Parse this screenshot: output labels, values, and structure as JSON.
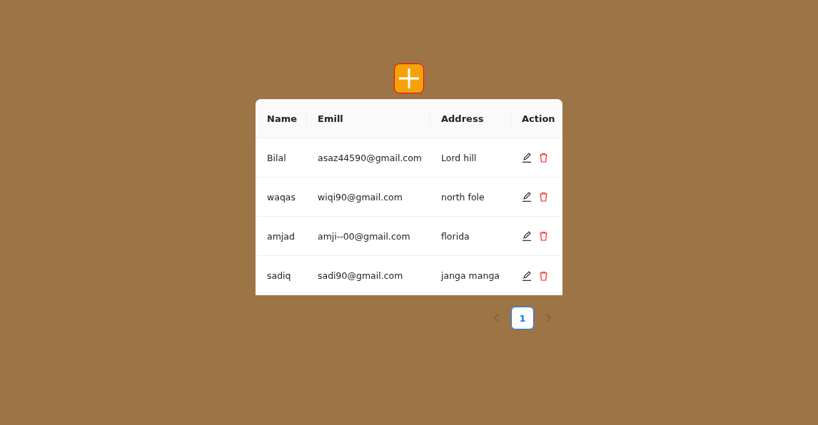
{
  "table": {
    "columns": [
      "Name",
      "Emill",
      "Address",
      "Action"
    ],
    "rows": [
      {
        "name": "Bilal",
        "email": "asaz44590@gmail.com",
        "address": "Lord hill"
      },
      {
        "name": "waqas",
        "email": "wiqi90@gmail.com",
        "address": "north fole"
      },
      {
        "name": "amjad",
        "email": "amji--00@gmail.com",
        "address": "florida"
      },
      {
        "name": "sadiq",
        "email": "sadi90@gmail.com",
        "address": "janga manga"
      }
    ]
  },
  "pagination": {
    "prev_disabled": true,
    "next_disabled": true,
    "pages": [
      {
        "label": "1",
        "selected": true
      }
    ]
  }
}
